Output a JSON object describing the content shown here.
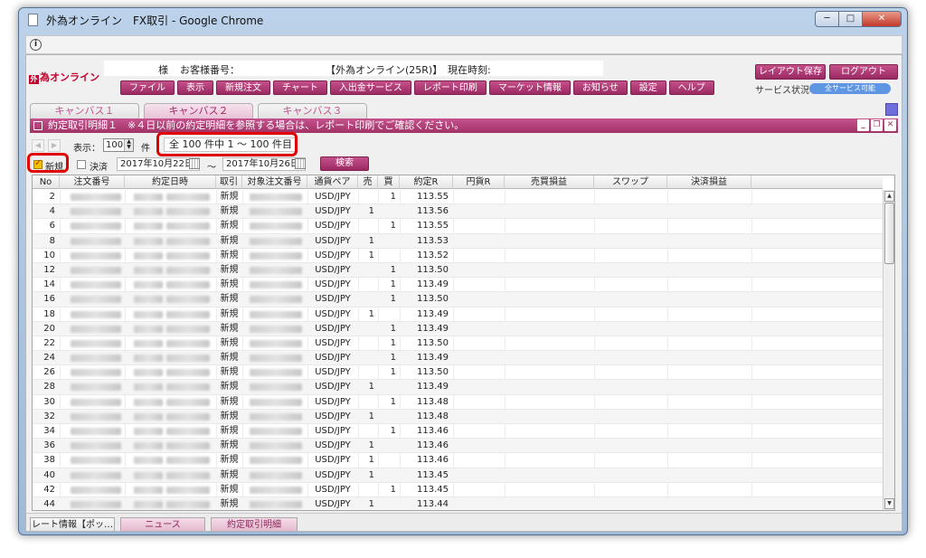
{
  "window": {
    "title": "外為オンライン　FX取引 - Google Chrome",
    "controls": {
      "minimize": "─",
      "maximize": "□",
      "close": "✕"
    }
  },
  "infobar": {
    "icon_glyph": "i"
  },
  "brand": {
    "mark": "外",
    "name": "為オンライン"
  },
  "customer": {
    "sama": "様",
    "number_label": "お客様番号：",
    "server": "【外為オンライン(25R)】",
    "time_label": "現在時刻:"
  },
  "menu": [
    "ファイル",
    "表示",
    "新規注文",
    "チャート",
    "入出金サービス",
    "レポート印刷",
    "マーケット情報",
    "お知らせ",
    "設定",
    "ヘルプ"
  ],
  "top_right": {
    "layout_save": "レイアウト保存",
    "logout": "ログアウト",
    "service_label": "サービス状況",
    "service_status": "全サービス可能"
  },
  "canvas_tabs": [
    {
      "label": "キャンバス１",
      "active": false
    },
    {
      "label": "キャンバス２",
      "active": true
    },
    {
      "label": "キャンバス３",
      "active": false
    }
  ],
  "panel": {
    "title": "約定取引明細１　※４日以前の約定明細を参照する場合は、レポート印刷でご確認ください。",
    "controls": [
      "_",
      "❐",
      "✕"
    ]
  },
  "toolbar": {
    "prev": "◀",
    "next": "▶",
    "display_label": "表示：",
    "per_page": "100",
    "unit": "件",
    "count_text": "全 100 件中 1 ～ 100 件目",
    "filter_new": "新規",
    "filter_settle": "決済",
    "date_from": "2017年10月22日",
    "tilde": "～",
    "date_to": "2017年10月26日",
    "search": "検索"
  },
  "grid": {
    "headers": [
      "No",
      "注文番号",
      "約定日時",
      "取引",
      "対象注文番号",
      "通貨ペア",
      "売",
      "買",
      "約定R",
      "円貨R",
      "売買損益",
      "スワップ",
      "決済損益"
    ],
    "rows": [
      {
        "no": "2",
        "type": "新規",
        "pair": "USD/JPY",
        "sell": "",
        "buy": "1",
        "rate": "113.55"
      },
      {
        "no": "4",
        "type": "新規",
        "pair": "USD/JPY",
        "sell": "1",
        "buy": "",
        "rate": "113.56"
      },
      {
        "no": "6",
        "type": "新規",
        "pair": "USD/JPY",
        "sell": "",
        "buy": "1",
        "rate": "113.55"
      },
      {
        "no": "8",
        "type": "新規",
        "pair": "USD/JPY",
        "sell": "1",
        "buy": "",
        "rate": "113.53"
      },
      {
        "no": "10",
        "type": "新規",
        "pair": "USD/JPY",
        "sell": "1",
        "buy": "",
        "rate": "113.52"
      },
      {
        "no": "12",
        "type": "新規",
        "pair": "USD/JPY",
        "sell": "",
        "buy": "1",
        "rate": "113.50"
      },
      {
        "no": "14",
        "type": "新規",
        "pair": "USD/JPY",
        "sell": "",
        "buy": "1",
        "rate": "113.49"
      },
      {
        "no": "16",
        "type": "新規",
        "pair": "USD/JPY",
        "sell": "",
        "buy": "1",
        "rate": "113.50"
      },
      {
        "no": "18",
        "type": "新規",
        "pair": "USD/JPY",
        "sell": "1",
        "buy": "",
        "rate": "113.49"
      },
      {
        "no": "20",
        "type": "新規",
        "pair": "USD/JPY",
        "sell": "",
        "buy": "1",
        "rate": "113.49"
      },
      {
        "no": "22",
        "type": "新規",
        "pair": "USD/JPY",
        "sell": "",
        "buy": "1",
        "rate": "113.50"
      },
      {
        "no": "24",
        "type": "新規",
        "pair": "USD/JPY",
        "sell": "",
        "buy": "1",
        "rate": "113.49"
      },
      {
        "no": "26",
        "type": "新規",
        "pair": "USD/JPY",
        "sell": "",
        "buy": "1",
        "rate": "113.50"
      },
      {
        "no": "28",
        "type": "新規",
        "pair": "USD/JPY",
        "sell": "1",
        "buy": "",
        "rate": "113.49"
      },
      {
        "no": "30",
        "type": "新規",
        "pair": "USD/JPY",
        "sell": "",
        "buy": "1",
        "rate": "113.48"
      },
      {
        "no": "32",
        "type": "新規",
        "pair": "USD/JPY",
        "sell": "1",
        "buy": "",
        "rate": "113.48"
      },
      {
        "no": "34",
        "type": "新規",
        "pair": "USD/JPY",
        "sell": "",
        "buy": "1",
        "rate": "113.46"
      },
      {
        "no": "36",
        "type": "新規",
        "pair": "USD/JPY",
        "sell": "1",
        "buy": "",
        "rate": "113.46"
      },
      {
        "no": "38",
        "type": "新規",
        "pair": "USD/JPY",
        "sell": "1",
        "buy": "",
        "rate": "113.46"
      },
      {
        "no": "40",
        "type": "新規",
        "pair": "USD/JPY",
        "sell": "1",
        "buy": "",
        "rate": "113.45"
      },
      {
        "no": "42",
        "type": "新規",
        "pair": "USD/JPY",
        "sell": "",
        "buy": "1",
        "rate": "113.45"
      },
      {
        "no": "44",
        "type": "新規",
        "pair": "USD/JPY",
        "sell": "1",
        "buy": "",
        "rate": "113.44"
      }
    ]
  },
  "scrollbar": {
    "up": "▲",
    "down": "▼"
  },
  "bottom_tabs": [
    "レート情報【ポッ…",
    "ニュース",
    "約定取引明細"
  ],
  "colors": {
    "accent": "#a03366",
    "highlight_ring": "#e10000",
    "brand": "#c4002f"
  }
}
